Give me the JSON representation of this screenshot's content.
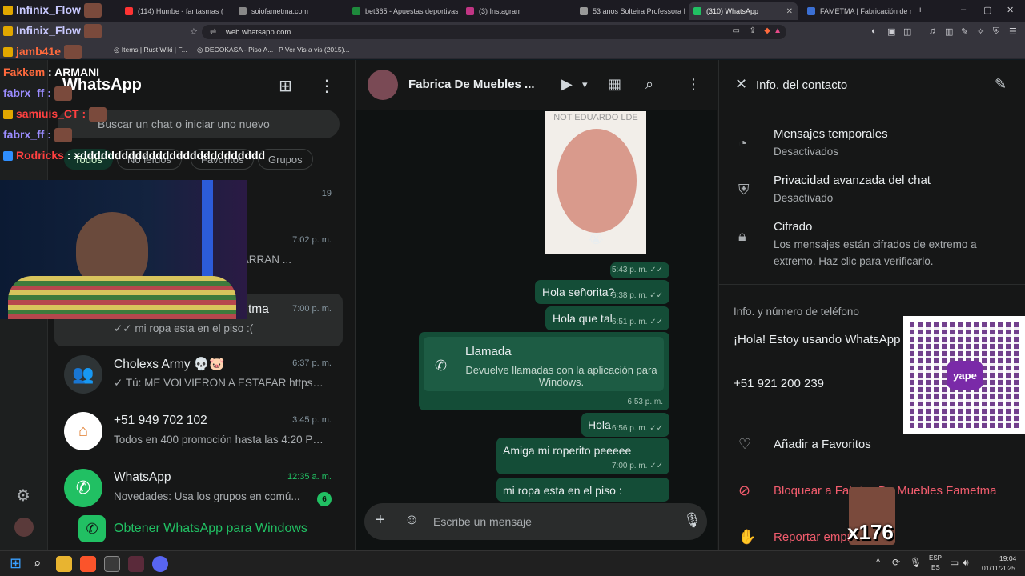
{
  "browser": {
    "tabs": [
      {
        "label": "(114) Humbe - fantasmas (",
        "color": "#ff3333"
      },
      {
        "label": "soiofametma.com",
        "color": "#888888"
      },
      {
        "label": "bet365 - Apuestas deportivas e",
        "color": "#1e8a3c"
      },
      {
        "label": "(3) Instagram",
        "color": "#c13584"
      },
      {
        "label": "53 anos Solteira Professora Pr",
        "color": "#999999"
      },
      {
        "label": "(310) WhatsApp",
        "color": "#21c063",
        "active": true
      },
      {
        "label": "FAMETMA | Fabricación de mu",
        "color": "#3b6fd4"
      }
    ],
    "url": "web.whatsapp.com",
    "bookmarks": [
      "Items | Rust Wiki | F...",
      "DECOKASA - Piso A...",
      "Ver Vis a vis (2015)..."
    ]
  },
  "stream_chat": [
    {
      "user": "Infinix_Flow",
      "text": "",
      "color": "#c9c9ff"
    },
    {
      "user": "Infinix_Flow",
      "text": "",
      "color": "#c9c9ff"
    },
    {
      "user": "jamb41e",
      "text": "",
      "color": "#ff6a3d"
    },
    {
      "user": "Fakkem",
      "text": "ARMANI",
      "color": "#ff6a3d"
    },
    {
      "user": "fabrx_ff",
      "text": "",
      "color": "#9b8cff"
    },
    {
      "user": "samiuis_CT",
      "text": "",
      "color": "#ff4040"
    },
    {
      "user": "fabrx_ff",
      "text": "",
      "color": "#9b8cff"
    },
    {
      "user": "Rodricks",
      "text": "xddddddddddddddddddddddddddd",
      "color": "#ff4040"
    }
  ],
  "sidebar": {
    "title": "WhatsApp",
    "search_placeholder": "Buscar un chat o iniciar uno nuevo",
    "filters": [
      "Todos",
      "No leídos",
      "Favoritos",
      "Grupos"
    ],
    "get_windows": "Obtener WhatsApp para Windows"
  },
  "chats": [
    {
      "name": "",
      "time": "19",
      "preview": ""
    },
    {
      "name": "",
      "time": "7:02 p. m.",
      "preview": "O TE AGARRAN ..."
    },
    {
      "name": "tma",
      "time": "7:00 p. m.",
      "preview": "✓✓ mi ropa esta en el piso :(",
      "selected": true
    },
    {
      "name": "Cholexs Army 💀🐷",
      "time": "6:37 p. m.",
      "preview": "✓ Tú: ME VOLVIERON A ESTAFAR https://ki..."
    },
    {
      "name": "+51 949 702 102",
      "time": "3:45 p. m.",
      "preview": "Todos en 400 promoción hasta las 4:20 PM ..."
    },
    {
      "name": "WhatsApp",
      "time": "12:35 a. m.",
      "preview": "Novedades: Usa los grupos en comú...",
      "badge": "6"
    }
  ],
  "conversation": {
    "name": "Fabrica De Muebles ...",
    "image_caption": "NOT EDUARDO LDE",
    "messages": [
      {
        "text": "",
        "time": "5:43 p. m. ✓✓"
      },
      {
        "text": "Hola señorita?",
        "time": "6:38 p. m. ✓✓"
      },
      {
        "text": "Hola que tal",
        "time": "6:51 p. m. ✓✓"
      },
      {
        "call_title": "Llamada",
        "call_sub": "Devuelve llamadas con la aplicación para Windows.",
        "time": "6:53 p. m."
      },
      {
        "text": "Hola",
        "time": "6:56 p. m. ✓✓"
      },
      {
        "text": "Amiga mi roperito peeeee",
        "time": "7:00 p. m. ✓✓"
      },
      {
        "text": "mi ropa esta en el piso :",
        "time": ""
      }
    ],
    "composer_placeholder": "Escribe un mensaje"
  },
  "info": {
    "title": "Info. del contacto",
    "items": [
      {
        "title": "Mensajes temporales",
        "sub": "Desactivados"
      },
      {
        "title": "Privacidad avanzada del chat",
        "sub": "Desactivado"
      },
      {
        "title": "Cifrado",
        "sub": "Los mensajes están cifrados de extremo a extremo. Haz clic para verificarlo."
      }
    ],
    "section": "Info. y número de teléfono",
    "about": "¡Hola! Estoy usando WhatsApp",
    "phone": "+51 921 200 239",
    "actions": [
      "Añadir a Favoritos",
      "Bloquear a Fabrica De Muebles Fametma",
      "Reportar empresa"
    ]
  },
  "overlay": {
    "counter": "x176",
    "qr_label": "yape"
  },
  "taskbar": {
    "lang": "ESP",
    "lang2": "ES",
    "time": "19:04",
    "date": "01/11/2025"
  }
}
